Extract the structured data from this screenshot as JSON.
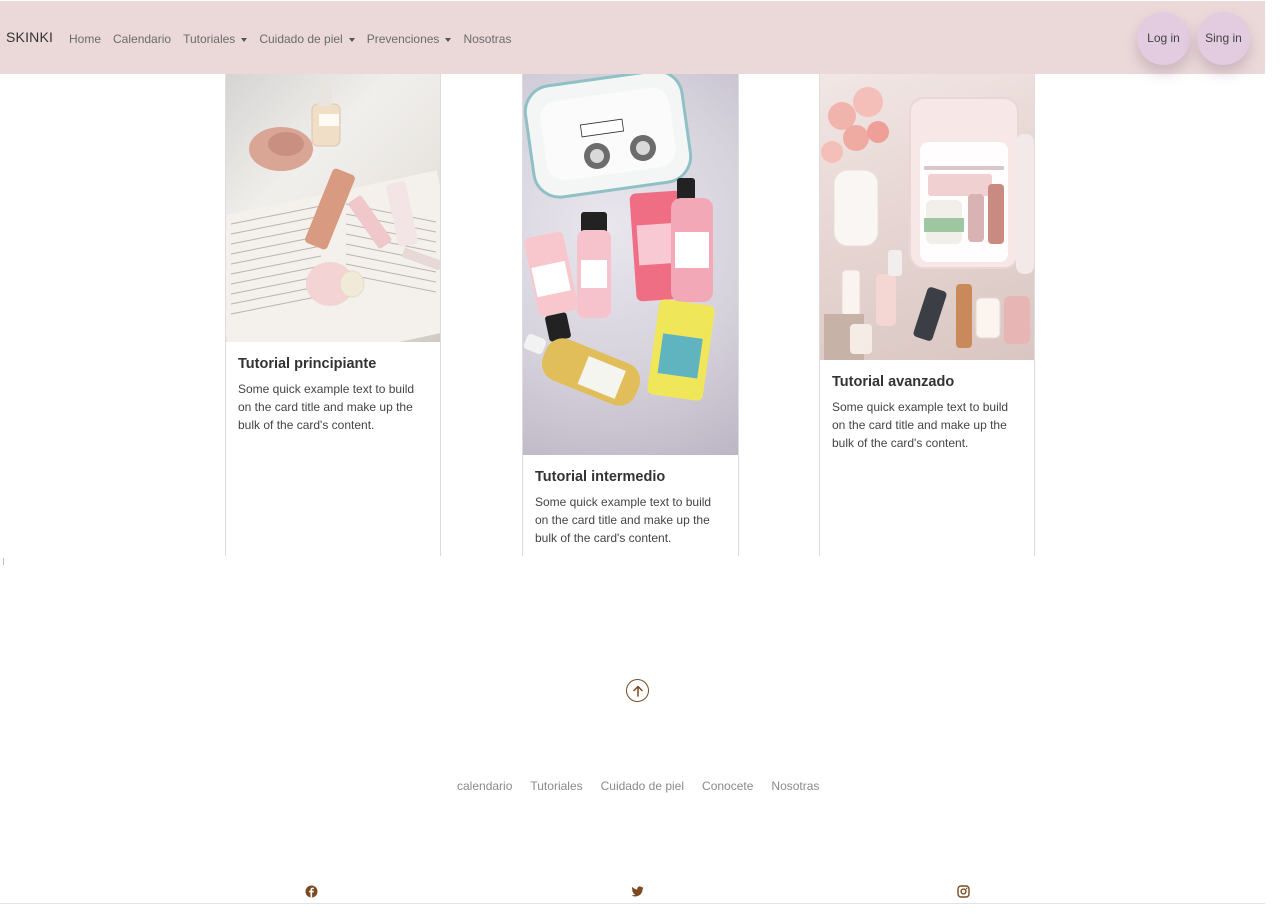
{
  "navbar": {
    "brand": "SKINKI",
    "links": [
      {
        "label": "Home",
        "dropdown": false
      },
      {
        "label": "Calendario",
        "dropdown": false
      },
      {
        "label": "Tutoriales",
        "dropdown": true
      },
      {
        "label": "Cuidado de piel",
        "dropdown": true
      },
      {
        "label": "Prevenciones",
        "dropdown": true
      },
      {
        "label": "Nosotras",
        "dropdown": false
      }
    ],
    "login_label": "Log in",
    "signin_label": "Sing in"
  },
  "cards": [
    {
      "title": "Tutorial principiante",
      "text": "Some quick example text to build on the card title and make up the bulk of the card's content.",
      "image": "skincare-flatlay-book-photo"
    },
    {
      "title": "Tutorial intermedio",
      "text": "Some quick example text to build on the card title and make up the bulk of the card's content.",
      "image": "skincare-bottles-fur-photo"
    },
    {
      "title": "Tutorial avanzado",
      "text": "Some quick example text to build on the card title and make up the bulk of the card's content.",
      "image": "skincare-fridge-photo"
    }
  ],
  "footer": {
    "links": [
      "calendario",
      "Tutoriales",
      "Cuidado de piel",
      "Conocete",
      "Nosotras"
    ],
    "icons": [
      "arrow-up-circle-icon",
      "facebook-icon",
      "twitter-icon",
      "instagram-icon"
    ]
  },
  "colors": {
    "navbar_bg": "#ebd9da",
    "auth_button_bg": "#e3cbe0",
    "footer_icon": "#7a4a20"
  }
}
